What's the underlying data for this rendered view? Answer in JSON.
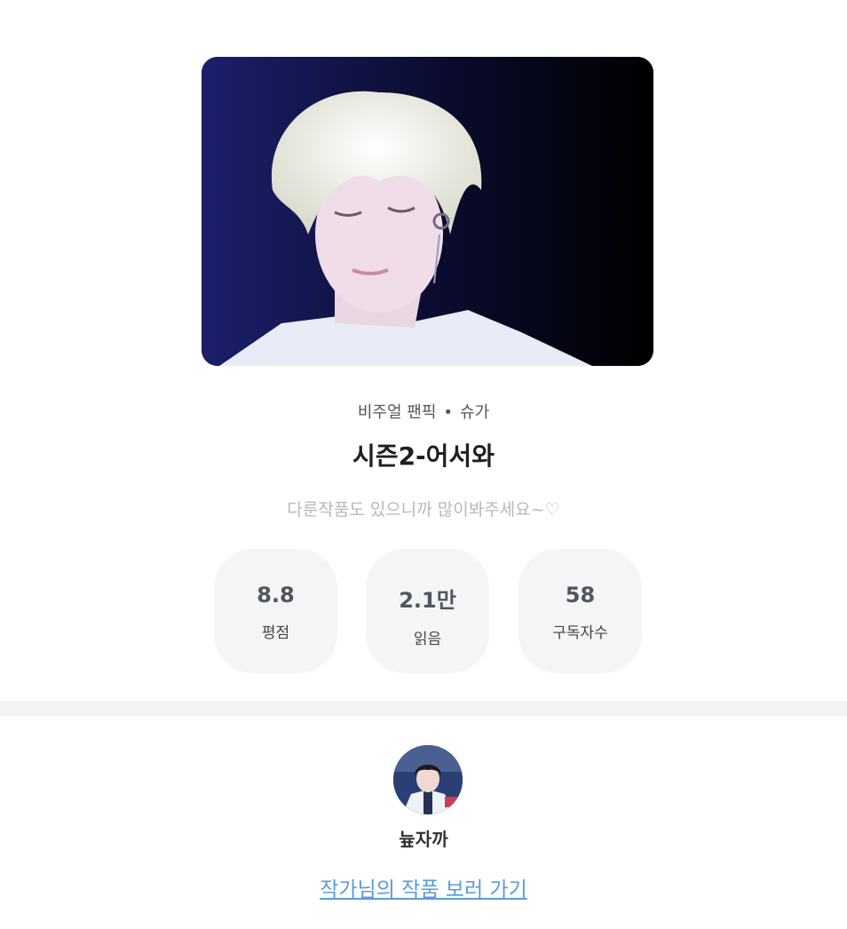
{
  "work": {
    "category": "비주얼 팬픽",
    "separator": "•",
    "character": "슈가",
    "title": "시즌2-어서와",
    "description": "다룬작품도 있으니까 많이봐주세요~♡"
  },
  "stats": [
    {
      "value": "8.8",
      "label": "평점"
    },
    {
      "value": "2.1만",
      "label": "읽음"
    },
    {
      "value": "58",
      "label": "구독자수"
    }
  ],
  "author": {
    "name": "늎자까",
    "more_link": "작가님의 작품 보러 가기"
  },
  "colors": {
    "link": "#5b9bdc",
    "stat_bg": "#f4f5f7",
    "muted_text": "#b5b8bd"
  }
}
